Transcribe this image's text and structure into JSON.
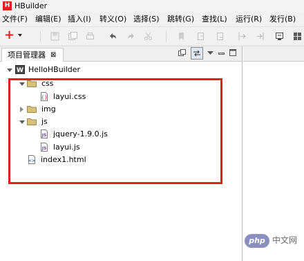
{
  "window": {
    "app_icon": "H",
    "title": "HBuilder"
  },
  "menu": [
    {
      "label": "文件(F)"
    },
    {
      "label": "编辑(E)"
    },
    {
      "label": "插入(I)"
    },
    {
      "label": "转义(O)"
    },
    {
      "label": "选择(S)"
    },
    {
      "label": "跳转(G)"
    },
    {
      "label": "查找(L)"
    },
    {
      "label": "运行(R)"
    },
    {
      "label": "发行(B)"
    }
  ],
  "toolbar": {
    "new_icon": "plus-icon",
    "icons": [
      "save-icon",
      "save-all-icon",
      "print-icon",
      "undo-icon",
      "redo-icon",
      "cut-icon",
      "bookmark-icon",
      "prev-doc-icon",
      "next-doc-icon",
      "jump-in-icon",
      "jump-out-icon",
      "preview-icon",
      "grid-icon"
    ]
  },
  "explorer": {
    "tab_label": "项目管理器",
    "tab_close": "⊠",
    "tree": [
      {
        "label": "HelloHBuilder",
        "icon": "project-icon",
        "expanded": true
      },
      {
        "label": "css",
        "icon": "folder-icon",
        "expanded": true
      },
      {
        "label": "layui.css",
        "icon": "css-file-icon"
      },
      {
        "label": "img",
        "icon": "folder-icon",
        "expanded": false
      },
      {
        "label": "js",
        "icon": "folder-icon",
        "expanded": true
      },
      {
        "label": "jquery-1.9.0.js",
        "icon": "js-file-icon"
      },
      {
        "label": "layui.js",
        "icon": "js-file-icon"
      },
      {
        "label": "index1.html",
        "icon": "html-file-icon"
      }
    ]
  },
  "colors": {
    "highlight": "#e22020",
    "brand": "#d9251b"
  },
  "watermark": {
    "logo": "php",
    "text": "中文网"
  }
}
